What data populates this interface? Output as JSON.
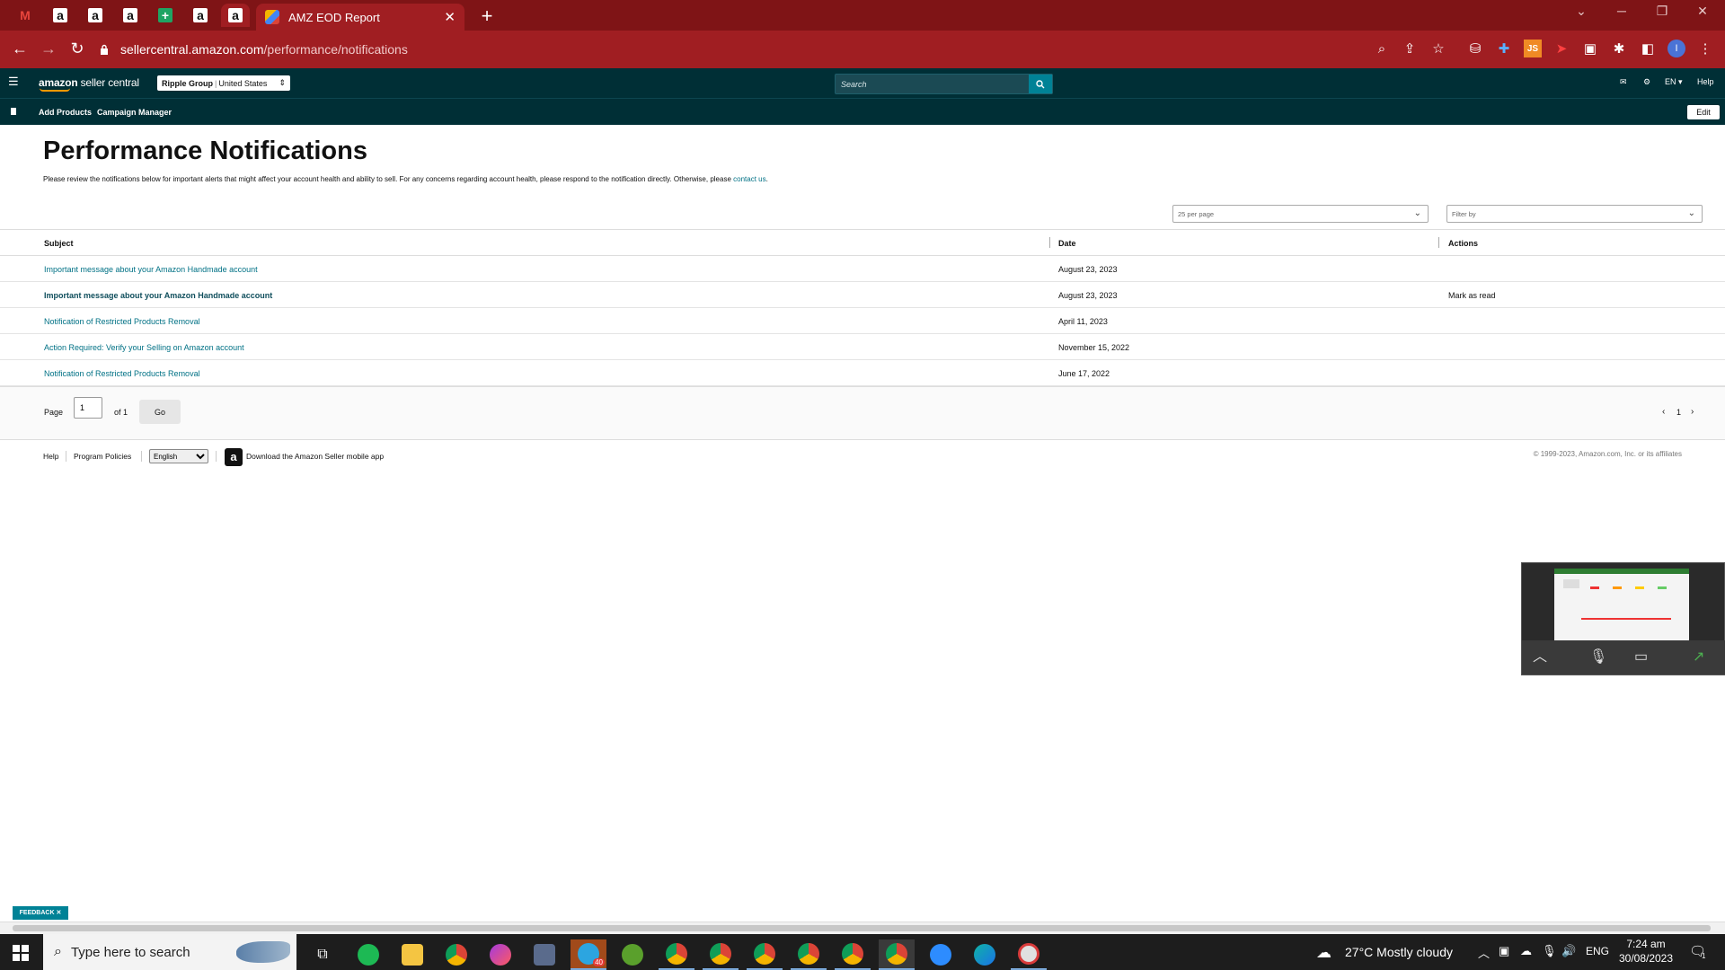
{
  "browser": {
    "tabs": [
      {
        "icon": "gmail-icon",
        "glyph": "M"
      },
      {
        "icon": "amazon-icon",
        "glyph": "a"
      },
      {
        "icon": "amazon-icon",
        "glyph": "a"
      },
      {
        "icon": "amazon-icon",
        "glyph": "a"
      },
      {
        "icon": "sheets-icon",
        "glyph": "+"
      },
      {
        "icon": "amazon-icon",
        "glyph": "a"
      },
      {
        "icon": "amazon-icon",
        "glyph": "a"
      }
    ],
    "active_tab_title": "AMZ EOD Report",
    "url_domain": "sellercentral.amazon.com",
    "url_path": "/performance/notifications",
    "accent": "#7f1416"
  },
  "header": {
    "logo_text_bold": "amazon",
    "logo_text": " seller central",
    "account_name": "Ripple Group",
    "account_region": "United States",
    "search_placeholder": "Search",
    "language": "EN",
    "help": "Help",
    "bg_color": "#002f36"
  },
  "nav": {
    "links": [
      "Add Products",
      "Campaign Manager"
    ],
    "edit_label": "Edit"
  },
  "page": {
    "title": "Performance Notifications",
    "description": "Please review the notifications below for important alerts that might affect your account health and ability to sell. For any concerns regarding account health, please respond to the notification directly. Otherwise, please ",
    "contact_link": "contact us",
    "per_page": "25 per page",
    "filter_placeholder": "Filter by"
  },
  "table": {
    "columns": [
      "Subject",
      "Date",
      "Actions"
    ],
    "rows": [
      {
        "subject": "Important message about your Amazon Handmade account",
        "date": "August 23, 2023",
        "action": "",
        "bold": false
      },
      {
        "subject": "Important message about your Amazon Handmade account",
        "date": "August 23, 2023",
        "action": "Mark as read",
        "bold": true
      },
      {
        "subject": "Notification of Restricted Products Removal",
        "date": "April 11, 2023",
        "action": "",
        "bold": false
      },
      {
        "subject": "Action Required: Verify your Selling on Amazon account",
        "date": "November 15, 2022",
        "action": "",
        "bold": false
      },
      {
        "subject": "Notification of Restricted Products Removal",
        "date": "June 17, 2022",
        "action": "",
        "bold": false
      }
    ]
  },
  "pager": {
    "page_label": "Page",
    "page_value": "1",
    "of_label": "of 1",
    "go_label": "Go",
    "current": "1"
  },
  "footer": {
    "help": "Help",
    "policies": "Program Policies",
    "language": "English",
    "app_text": "Download the Amazon Seller mobile app",
    "copyright": "© 1999-2023, Amazon.com, Inc. or its affiliates"
  },
  "feedback_label": "FEEDBACK ✕",
  "taskbar": {
    "search_placeholder": "Type here to search",
    "weather": "27°C  Mostly cloudy",
    "lang": "ENG",
    "time": "7:24 am",
    "date": "30/08/2023",
    "telegram_badge": "40",
    "notif_count": "1"
  }
}
